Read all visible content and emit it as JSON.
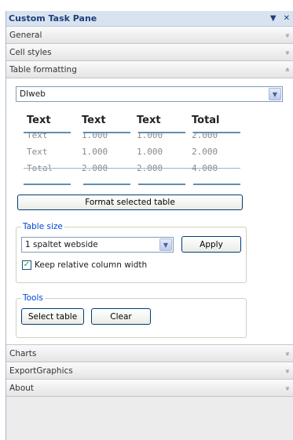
{
  "pane": {
    "title": "Custom Task Pane",
    "dropdown_glyph": "▼",
    "close_glyph": "✕"
  },
  "sections": {
    "general": "General",
    "cell_styles": "Cell styles",
    "table_formatting": "Table formatting",
    "charts": "Charts",
    "export_graphics": "ExportGraphics",
    "about": "About"
  },
  "chevrons": {
    "expand": "»",
    "collapse": "«"
  },
  "table_formatting": {
    "style_select": {
      "value": "DIweb"
    },
    "preview": {
      "headers": [
        "Text",
        "Text",
        "Text",
        "Total"
      ],
      "rows": [
        [
          "Text",
          "1.000",
          "1.000",
          "2.000"
        ],
        [
          "Text",
          "1.000",
          "1.000",
          "2.000"
        ],
        [
          "Total",
          "2.000",
          "2.000",
          "4.000"
        ]
      ]
    },
    "format_button": "Format selected table",
    "table_size": {
      "legend": "Table size",
      "select_value": "1 spaltet webside",
      "apply_button": "Apply",
      "keep_width_label": "Keep relative column width",
      "keep_width_checked": true
    },
    "tools": {
      "legend": "Tools",
      "select_table_button": "Select table",
      "clear_button": "Clear"
    }
  },
  "colors": {
    "title_text": "#1c3f7a",
    "legend_text": "#0046d5",
    "preview_line": "#5e8fb0",
    "check_mark": "#21a121"
  }
}
